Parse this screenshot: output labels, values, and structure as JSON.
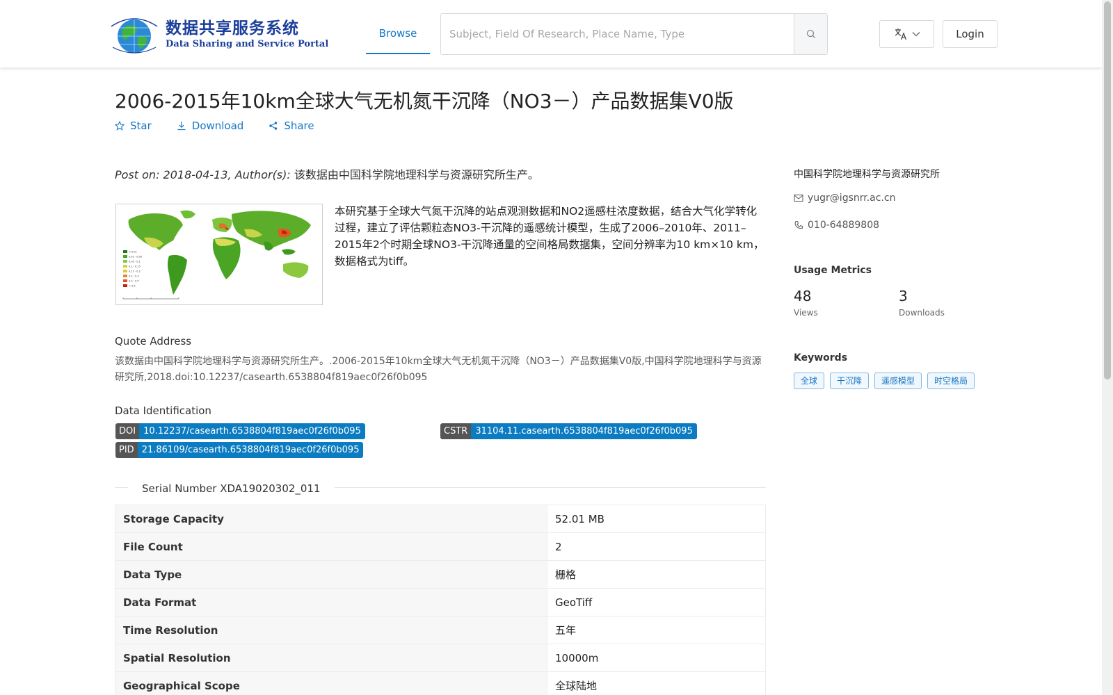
{
  "header": {
    "logo_cn": "数据共享服务系统",
    "logo_en": "Data Sharing and Service Portal",
    "nav_browse": "Browse",
    "search_placeholder": "Subject, Field Of Research, Place Name, Type",
    "login": "Login"
  },
  "dataset": {
    "title": "2006-2015年10km全球大气无机氮干沉降（NO3－）产品数据集V0版",
    "actions": {
      "star": "Star",
      "download": "Download",
      "share": "Share"
    },
    "post_label": "Post on: 2018-04-13, Author(s):",
    "author": " 该数据由中国科学院地理科学与资源研究所生产。",
    "abstract": "本研究基于全球大气氮干沉降的站点观测数据和NO2遥感柱浓度数据，结合大气化学转化过程，建立了评估颗粒态NO3-干沉降的遥感统计模型，生成了2006–2010年、2011–2015年2个时期全球NO3-干沉降通量的空间格局数据集，空间分辨率为10 km×10 km，数据格式为tiff。",
    "quote_label": "Quote Address",
    "quote_text": "该数据由中国科学院地理科学与资源研究所生产。.2006-2015年10km全球大气无机氮干沉降（NO3－）产品数据集V0版,中国科学院地理科学与资源研究所,2018.doi:10.12237/casearth.6538804f819aec0f26f0b095",
    "ident_label": "Data Identification",
    "identifiers": {
      "doi": {
        "key": "DOI",
        "value": "10.12237/casearth.6538804f819aec0f26f0b095"
      },
      "cstr": {
        "key": "CSTR",
        "value": "31104.11.casearth.6538804f819aec0f26f0b095"
      },
      "pid": {
        "key": "PID",
        "value": "21.86109/casearth.6538804f819aec0f26f0b095"
      }
    },
    "serial_number": "Serial Number XDA19020302_011",
    "info_rows": [
      {
        "key": "Storage Capacity",
        "value": "52.01 MB"
      },
      {
        "key": "File Count",
        "value": "2"
      },
      {
        "key": "Data Type",
        "value": "栅格"
      },
      {
        "key": "Data Format",
        "value": "GeoTiff"
      },
      {
        "key": "Time Resolution",
        "value": "五年"
      },
      {
        "key": "Spatial Resolution",
        "value": "10000m"
      },
      {
        "key": "Geographical Scope",
        "value": "全球陆地"
      }
    ]
  },
  "sidebar": {
    "org": "中国科学院地理科学与资源研究所",
    "email": "yugr@igsnrr.ac.cn",
    "phone": "010-64889808",
    "metrics_title": "Usage Metrics",
    "views": "48",
    "views_label": "Views",
    "downloads": "3",
    "downloads_label": "Downloads",
    "keywords_title": "Keywords",
    "keywords": [
      "全球",
      "干沉降",
      "遥感模型",
      "时空格局"
    ]
  },
  "colors": {
    "accent": "#1677c5",
    "badge_key": "#555555",
    "badge_value": "#0b7cc1"
  }
}
